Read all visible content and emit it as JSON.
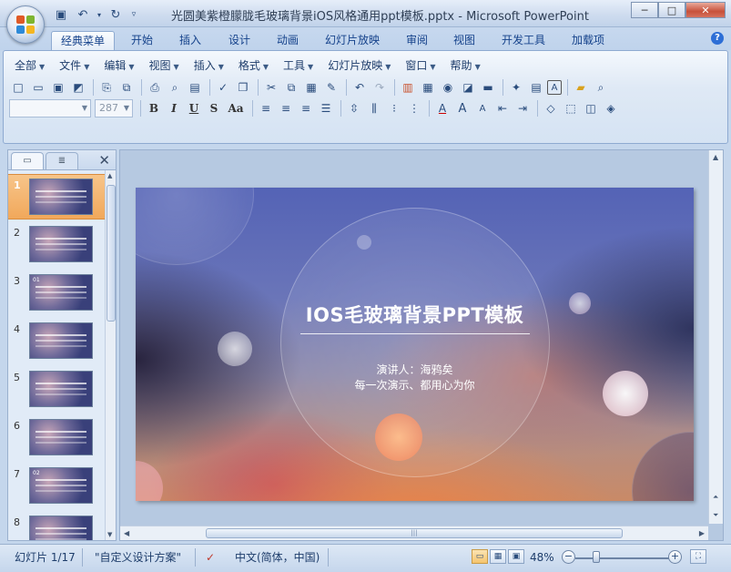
{
  "window": {
    "title": "光圆美紫橙朦胧毛玻璃背景iOS风格通用ppt模板.pptx - Microsoft PowerPoint",
    "minimize": "─",
    "maximize": "□",
    "close": "✕"
  },
  "ribbon_tabs": [
    "经典菜单",
    "开始",
    "插入",
    "设计",
    "动画",
    "幻灯片放映",
    "审阅",
    "视图",
    "开发工具",
    "加载项"
  ],
  "active_tab": "经典菜单",
  "classic_menus": [
    "全部",
    "文件",
    "编辑",
    "视图",
    "插入",
    "格式",
    "工具",
    "幻灯片放映",
    "窗口",
    "帮助"
  ],
  "font_combo": {
    "name": "",
    "size": "287"
  },
  "format_buttons": [
    "B",
    "I",
    "U",
    "S",
    "Aa"
  ],
  "slides_panel": {
    "tabs": [
      "slides-tab",
      "outline-tab"
    ],
    "close": "✕",
    "thumbnails": [
      {
        "num": "1",
        "tag": ""
      },
      {
        "num": "2",
        "tag": ""
      },
      {
        "num": "3",
        "tag": "01"
      },
      {
        "num": "4",
        "tag": ""
      },
      {
        "num": "5",
        "tag": ""
      },
      {
        "num": "6",
        "tag": ""
      },
      {
        "num": "7",
        "tag": "02"
      },
      {
        "num": "8",
        "tag": ""
      }
    ],
    "selected": 1
  },
  "slide": {
    "title": "IOS毛玻璃背景PPT模板",
    "presenter": "演讲人：海鸦矣",
    "tagline": "每一次演示、都用心为你"
  },
  "status": {
    "slide_info": "幻灯片 1/17",
    "theme": "\"自定义设计方案\"",
    "language": "中文(简体，中国)",
    "zoom": "48%",
    "zoom_out": "−",
    "zoom_in": "+"
  },
  "colors": {
    "accent": "#15428b",
    "ribbon_bg": "#dfe9f5",
    "selected_thumb": "#f1a85b"
  }
}
